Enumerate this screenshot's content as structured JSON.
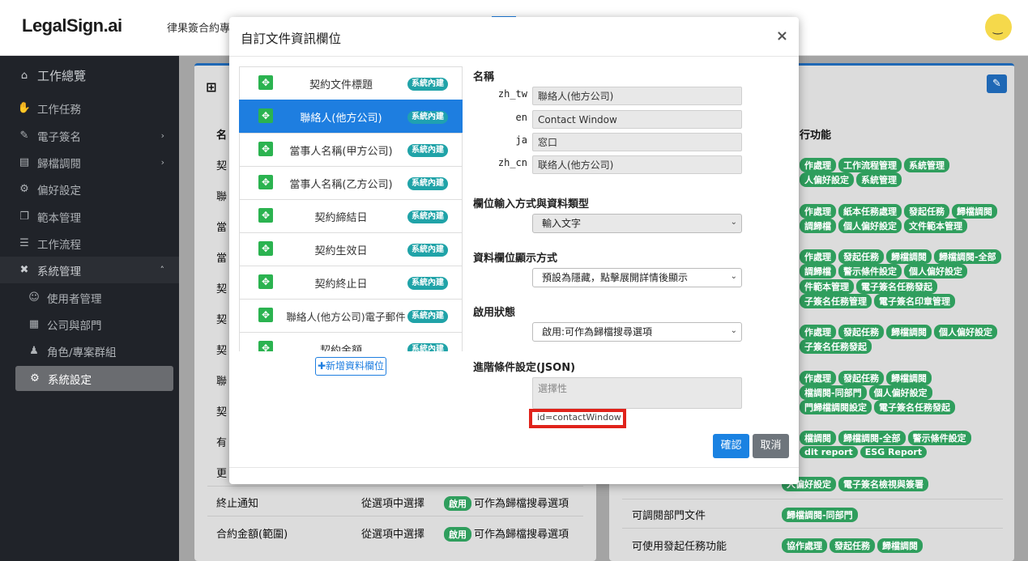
{
  "app": {
    "logo": "LegalSign.ai",
    "topnav": "律果簽合約專業",
    "avatar_face": "‿"
  },
  "sidebar": {
    "items": [
      {
        "label": "工作總覽",
        "icon": "home-icon"
      },
      {
        "label": "工作任務",
        "icon": "handshake-icon"
      },
      {
        "label": "電子簽名",
        "icon": "signature-icon"
      },
      {
        "label": "歸檔調閱",
        "icon": "archive-icon"
      },
      {
        "label": "偏好設定",
        "icon": "user-cog-icon"
      },
      {
        "label": "範本管理",
        "icon": "copy-icon"
      },
      {
        "label": "工作流程",
        "icon": "list-icon"
      },
      {
        "label": "系統管理",
        "icon": "tools-icon"
      },
      {
        "label": "使用者管理",
        "icon": "user-icon"
      },
      {
        "label": "公司與部門",
        "icon": "building-icon"
      },
      {
        "label": "角色/專案群組",
        "icon": "users-icon"
      },
      {
        "label": "系統設定",
        "icon": "gear-icon"
      }
    ]
  },
  "background": {
    "left_header": "名",
    "left_rows": [
      "契",
      "聯",
      "當",
      "當",
      "契",
      "契",
      "契",
      "聯",
      "契",
      "有",
      "更"
    ],
    "bottom_rows": [
      {
        "name": "終止通知",
        "mode": "從選項中選擇",
        "badge": "啟用",
        "desc": "可作為歸檔搜尋選項"
      },
      {
        "name": "合約金額(範圍)",
        "mode": "從選項中選擇",
        "badge": "啟用",
        "desc": "可作為歸檔搜尋選項"
      }
    ],
    "right_header": "行功能",
    "right_pill_rows": [
      [
        "作處理",
        "工作流程管理",
        "系統管理"
      ],
      [
        "人偏好設定",
        "系統管理"
      ],
      [
        "作處理",
        "紙本任務處理",
        "發起任務",
        "歸檔調閱"
      ],
      [
        "調歸檔",
        "個人偏好設定",
        "文件範本管理"
      ],
      [
        "作處理",
        "發起任務",
        "歸檔調閱",
        "歸檔調閱-全部"
      ],
      [
        "調歸檔",
        "警示條件設定",
        "個人偏好設定"
      ],
      [
        "件範本管理",
        "電子簽名任務發起"
      ],
      [
        "子簽名任務管理",
        "電子簽名印章管理"
      ],
      [
        "作處理",
        "發起任務",
        "歸檔調閱",
        "個人偏好設定"
      ],
      [
        "子簽名任務發起"
      ],
      [
        "作處理",
        "發起任務",
        "歸檔調閱"
      ],
      [
        "檔調閱-同部門",
        "個人偏好設定"
      ],
      [
        "門歸檔調閱設定",
        "電子簽名任務發起"
      ],
      [
        "檔調閱",
        "歸檔調閱-全部",
        "警示條件設定"
      ],
      [
        "dit report",
        "ESG Report"
      ],
      [
        "人偏好設定",
        "電子簽名檢視與簽署"
      ]
    ],
    "right_bottom_rows": [
      {
        "label": "可調閱部門文件",
        "pills": [
          "歸檔調閱-同部門"
        ]
      },
      {
        "label": "可使用發起任務功能",
        "pills": [
          "協作處理",
          "發起任務",
          "歸檔調閱"
        ]
      }
    ]
  },
  "modal": {
    "title": "自訂文件資訊欄位",
    "close": "×",
    "fields": [
      {
        "label": "契約文件標題",
        "badge": "系統內建"
      },
      {
        "label": "聯絡人(他方公司)",
        "badge": "系統內建"
      },
      {
        "label": "當事人名稱(甲方公司)",
        "badge": "系統內建"
      },
      {
        "label": "當事人名稱(乙方公司)",
        "badge": "系統內建"
      },
      {
        "label": "契約締結日",
        "badge": "系統內建"
      },
      {
        "label": "契約生效日",
        "badge": "系統內建"
      },
      {
        "label": "契約終止日",
        "badge": "系統內建"
      },
      {
        "label": "聯絡人(他方公司)電子郵件",
        "badge": "系統內建"
      },
      {
        "label": "契約金額",
        "badge": "系統內建"
      }
    ],
    "add_field": "✚新增資料欄位",
    "name_section": "名稱",
    "names": [
      {
        "lang": "zh_tw",
        "value": "聯絡人(他方公司)"
      },
      {
        "lang": "en",
        "value": "Contact Window"
      },
      {
        "lang": "ja",
        "value": "窓口"
      },
      {
        "lang": "zh_cn",
        "value": "联络人(他方公司)"
      }
    ],
    "input_section": "欄位輸入方式與資料類型",
    "input_value": "輸入文字",
    "display_section": "資料欄位顯示方式",
    "display_value": "預設為隱藏，點擊展開詳情後顯示",
    "status_section": "啟用狀態",
    "status_value": "啟用:可作為歸檔搜尋選項",
    "json_section": "進階條件設定(JSON)",
    "json_placeholder": "選擇性",
    "id_hint": "id=contactWindow",
    "ok": "確認",
    "cancel": "取消"
  },
  "colors": {
    "primary": "#1e7ee0",
    "success": "#2bb350",
    "badge": "#20a3a8",
    "highlight": "#e0231b",
    "sidebar": "#202329"
  }
}
